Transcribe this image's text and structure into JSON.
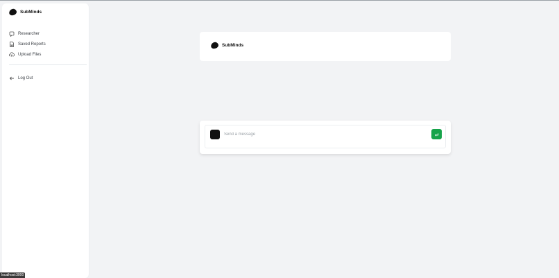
{
  "app": {
    "brand_name": "SubMinds"
  },
  "sidebar": {
    "items": [
      {
        "label": "Researcher",
        "icon": "chat-bubble-icon"
      },
      {
        "label": "Saved Reports",
        "icon": "bookmark-file-icon"
      },
      {
        "label": "Upload Files",
        "icon": "cloud-upload-icon"
      }
    ],
    "logout_label": "Log Out",
    "logout_icon": "arrow-left-icon"
  },
  "header": {
    "brand_name": "SubMinds"
  },
  "chat": {
    "placeholder": "Send a message",
    "send_icon": "enter-return-icon"
  },
  "status_bar": {
    "url": "localhost:3000"
  },
  "colors": {
    "background": "#f2f3f5",
    "panel": "#ffffff",
    "accent_green": "#16a34a",
    "text_dark": "#111111"
  }
}
